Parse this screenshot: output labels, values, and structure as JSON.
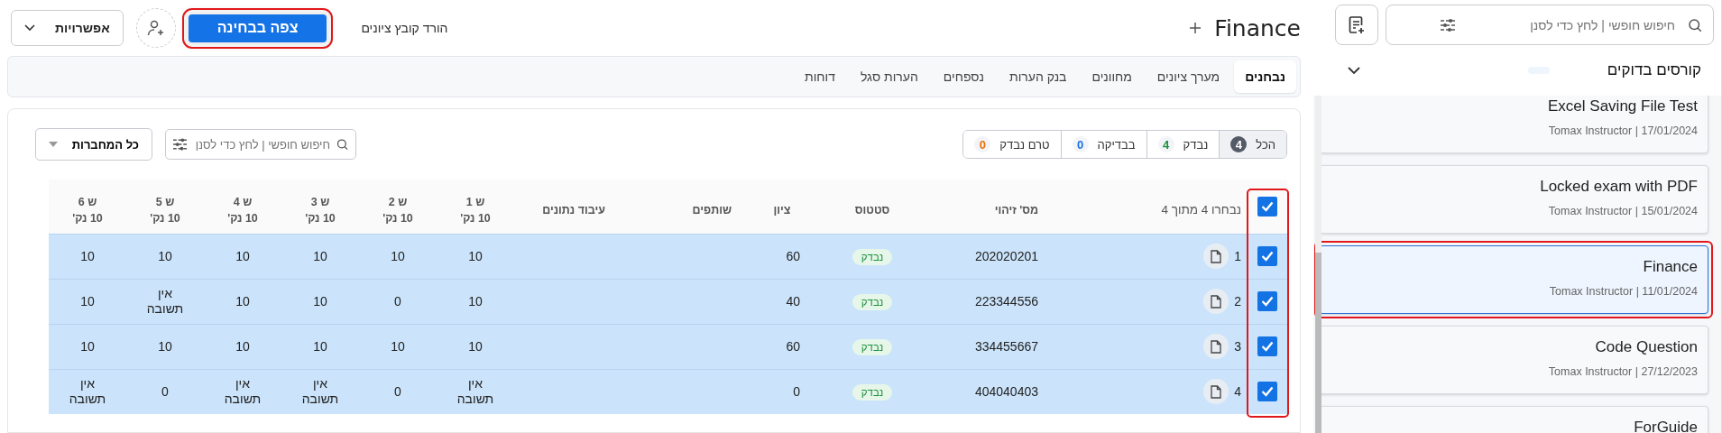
{
  "header": {
    "title": "Finance",
    "view_exam_button": {
      "label": "צפה בבחינה",
      "highlighted": true
    },
    "download_link": "הורד קובץ ציונים",
    "options_button": "אפשרויות"
  },
  "tabs": [
    {
      "label": "נבחנים",
      "selected": true
    },
    {
      "label": "מערך ציונים",
      "selected": false
    },
    {
      "label": "מחוונים",
      "selected": false
    },
    {
      "label": "בנק הערות",
      "selected": false
    },
    {
      "label": "נספחים",
      "selected": false
    },
    {
      "label": "הערות סגל",
      "selected": false
    },
    {
      "label": "דוחות",
      "selected": false
    }
  ],
  "filters": [
    {
      "label": "הכל",
      "count": "4",
      "selected": true,
      "color": "#555b66"
    },
    {
      "label": "נבדק",
      "count": "4",
      "selected": false,
      "color": "#1e8e3e"
    },
    {
      "label": "בבדיקה",
      "count": "0",
      "selected": false,
      "color": "#1a73e8"
    },
    {
      "label": "טרם נבדק",
      "count": "0",
      "selected": false,
      "color": "#e8710a"
    }
  ],
  "search": {
    "placeholder": "חיפוש חופשי | לחץ כדי לסנן"
  },
  "notebooks_dropdown": "כל המחברות",
  "table": {
    "all_checked": true,
    "checkboxes_highlighted": true,
    "columns": [
      {
        "label": "נבחרו 4 מתוך 4"
      },
      {
        "label": "מס' זיהוי"
      },
      {
        "label": "סטטוס"
      },
      {
        "label": "ציון"
      },
      {
        "label": "שותפים"
      },
      {
        "label": "עיבוד נתונים"
      }
    ],
    "questions": [
      {
        "label": "ש 1",
        "points": "10 נק'"
      },
      {
        "label": "ש 2",
        "points": "10 נק'"
      },
      {
        "label": "ש 3",
        "points": "10 נק'"
      },
      {
        "label": "ש 4",
        "points": "10 נק'"
      },
      {
        "label": "ש 5",
        "points": "10 נק'"
      },
      {
        "label": "ש 6",
        "points": "10 נק'"
      }
    ],
    "rows": [
      {
        "selected": true,
        "number": "1",
        "id": "202020201",
        "status": "נבדק",
        "grade": "60",
        "answers": [
          "10",
          "10",
          "10",
          "10",
          "10",
          "10"
        ]
      },
      {
        "selected": true,
        "number": "2",
        "id": "223344556",
        "status": "נבדק",
        "grade": "40",
        "answers": [
          "10",
          "0",
          "10",
          "10",
          "אין תשובה",
          "10"
        ]
      },
      {
        "selected": true,
        "number": "3",
        "id": "334455667",
        "status": "נבדק",
        "grade": "60",
        "answers": [
          "10",
          "10",
          "10",
          "10",
          "10",
          "10"
        ]
      },
      {
        "selected": true,
        "number": "4",
        "id": "404040403",
        "status": "נבדק",
        "grade": "0",
        "answers": [
          "אין תשובה",
          "0",
          "אין תשובה",
          "אין תשובה",
          "0",
          "אין תשובה"
        ]
      }
    ]
  },
  "sidebar": {
    "search": {
      "placeholder": "חיפוש חופשי | לחץ כדי לסנן"
    },
    "section_title": "קורסים בדוקים",
    "courses": [
      {
        "title": "Excel Saving File Test",
        "meta": "Tomax Instructor | 17/01/2024",
        "selected": false,
        "highlighted": false
      },
      {
        "title": "Locked exam with PDF",
        "meta": "Tomax Instructor | 15/01/2024",
        "selected": false,
        "highlighted": false
      },
      {
        "title": "Finance",
        "meta": "Tomax Instructor | 11/01/2024",
        "selected": true,
        "highlighted": true
      },
      {
        "title": "Code Question",
        "meta": "Tomax Instructor | 27/12/2023",
        "selected": false,
        "highlighted": false
      },
      {
        "title": "ForGuide",
        "selected": false,
        "highlighted": false
      }
    ]
  }
}
